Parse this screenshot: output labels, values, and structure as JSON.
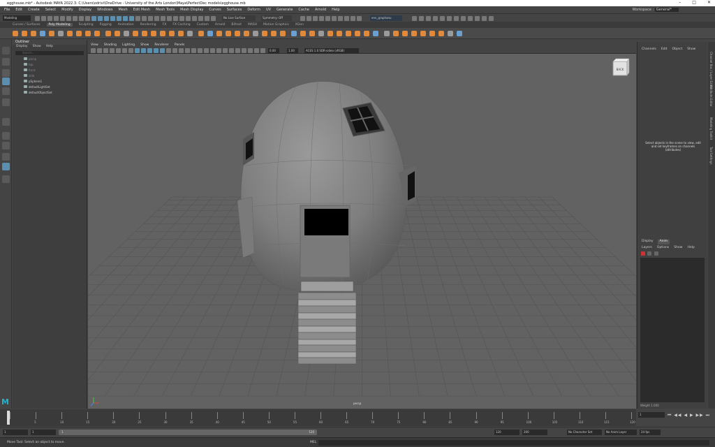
{
  "window": {
    "title": "egghouse.mb* - Autodesk MAYA 2022.3: C:\\Users\\odrivi\\OneDrive - University of the Arts London\\Maya\\PerfectDec models\\egghouse.mb",
    "controls": [
      "–",
      "□",
      "✕"
    ]
  },
  "menubar": {
    "items": [
      "File",
      "Edit",
      "Create",
      "Select",
      "Modify",
      "Display",
      "Windows",
      "Mesh",
      "Edit Mesh",
      "Mesh Tools",
      "Mesh Display",
      "Curves",
      "Surfaces",
      "Deform",
      "UV",
      "Generate",
      "Cache",
      "Arnold",
      "Help"
    ],
    "workspace_label": "Workspace :",
    "workspace_value": "General*"
  },
  "statusline": {
    "mode": "Modeling",
    "live_surface": "No Live Surface",
    "symmetry": "Symmetry: Off",
    "graph": "env_graphanu"
  },
  "shelf": {
    "tabs": [
      "Curves / Surfaces",
      "Poly Modeling",
      "Sculpting",
      "Rigging",
      "Animation",
      "Rendering",
      "FX",
      "FX Caching",
      "Custom",
      "Arnold",
      "Bifrost",
      "MASH",
      "Motion Graphics",
      "XGen"
    ],
    "active_tab": "Poly Modeling"
  },
  "outliner": {
    "title": "Outliner",
    "menu": [
      "Display",
      "Show",
      "Help"
    ],
    "search_placeholder": "Search...",
    "items": [
      {
        "label": "persp",
        "dim": true
      },
      {
        "label": "top",
        "dim": true
      },
      {
        "label": "front",
        "dim": true
      },
      {
        "label": "side",
        "dim": true
      },
      {
        "label": "pSphere1",
        "dim": false
      },
      {
        "label": "defaultLightSet",
        "dim": false
      },
      {
        "label": "defaultObjectSet",
        "dim": false
      }
    ]
  },
  "viewport": {
    "menu": [
      "View",
      "Shading",
      "Lighting",
      "Show",
      "Renderer",
      "Panels"
    ],
    "field_a": "0.00",
    "field_b": "1.00",
    "color_space": "ACES 1.0 SDR-video (sRGB)",
    "camera_label": "persp",
    "viewcube_label": "BACK"
  },
  "channelbox": {
    "menu": [
      "Channels",
      "Edit",
      "Object",
      "Show"
    ],
    "message": "Select objects in the scene to view, edit and set keyframes on channels (attributes)"
  },
  "layers": {
    "tabs": [
      "Display",
      "Anim"
    ],
    "active_tab": "Anim",
    "menu": [
      "Layers",
      "Options",
      "Show",
      "Help"
    ],
    "weight_label": "Weight",
    "weight_value": "1.000"
  },
  "sidetabs": [
    "Channel Box / Layer Editor",
    "Attribute Editor",
    "Modeling Toolkit",
    "Tool Settings"
  ],
  "timeslider": {
    "ticks": [
      "1",
      "5",
      "10",
      "15",
      "20",
      "25",
      "30",
      "35",
      "40",
      "45",
      "50",
      "55",
      "60",
      "65",
      "70",
      "75",
      "80",
      "85",
      "90",
      "95",
      "100",
      "105",
      "110",
      "115",
      "120"
    ],
    "current_frame": "1"
  },
  "rangebar": {
    "start": "1",
    "start2": "1",
    "range_inner": "1",
    "range_end_label": "120",
    "end": "120",
    "end2": "200",
    "character_set": "No Character Set",
    "anim_layer": "No Anim Layer",
    "fps": "24 fps"
  },
  "helpline": {
    "text": "Move Tool: Select an object to move.",
    "mel_label": "MEL"
  }
}
